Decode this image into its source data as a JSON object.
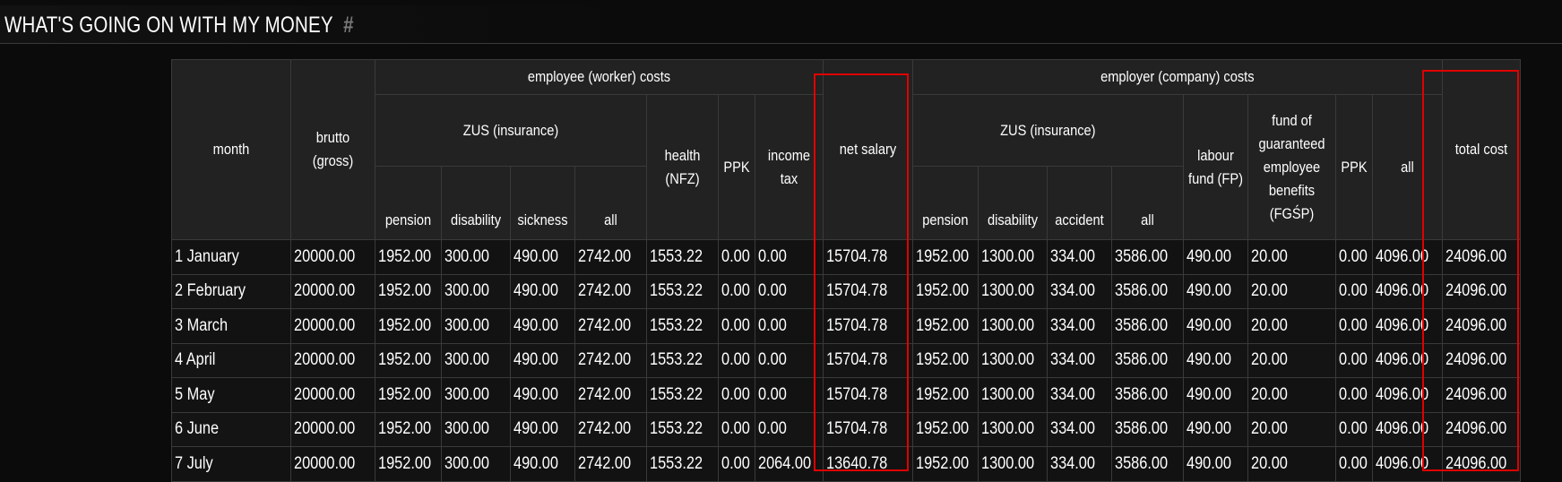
{
  "page": {
    "title": "WHAT'S GOING ON WITH MY MONEY",
    "anchor": "#"
  },
  "table": {
    "headers": {
      "month": "month",
      "gross": "brutto (gross)",
      "employee_group": "employee (worker) costs",
      "employer_group": "employer (company) costs",
      "zus": "ZUS (insurance)",
      "health": "health (NFZ)",
      "ppk": "PPK",
      "income_tax": "income tax",
      "net_salary": "net salary",
      "labour_fund": "labour fund (FP)",
      "fgsp": "fund of guaranteed employee benefits (FGŚP)",
      "all": "all",
      "total_cost": "total cost",
      "pension": "pension",
      "disability": "disability",
      "sickness": "sickness",
      "accident": "accident"
    },
    "rows": [
      {
        "month": "1 January",
        "gross": "20000.00",
        "e_pension": "1952.00",
        "e_disability": "300.00",
        "e_sickness": "490.00",
        "e_all": "2742.00",
        "health": "1553.22",
        "e_ppk": "0.00",
        "income_tax": "0.00",
        "net": "15704.78",
        "c_pension": "1952.00",
        "c_disability": "1300.00",
        "c_accident": "334.00",
        "c_all": "3586.00",
        "fp": "490.00",
        "fgsp": "20.00",
        "c_ppk": "0.00",
        "c_total_all": "4096.00",
        "total": "24096.00"
      },
      {
        "month": "2 February",
        "gross": "20000.00",
        "e_pension": "1952.00",
        "e_disability": "300.00",
        "e_sickness": "490.00",
        "e_all": "2742.00",
        "health": "1553.22",
        "e_ppk": "0.00",
        "income_tax": "0.00",
        "net": "15704.78",
        "c_pension": "1952.00",
        "c_disability": "1300.00",
        "c_accident": "334.00",
        "c_all": "3586.00",
        "fp": "490.00",
        "fgsp": "20.00",
        "c_ppk": "0.00",
        "c_total_all": "4096.00",
        "total": "24096.00"
      },
      {
        "month": "3 March",
        "gross": "20000.00",
        "e_pension": "1952.00",
        "e_disability": "300.00",
        "e_sickness": "490.00",
        "e_all": "2742.00",
        "health": "1553.22",
        "e_ppk": "0.00",
        "income_tax": "0.00",
        "net": "15704.78",
        "c_pension": "1952.00",
        "c_disability": "1300.00",
        "c_accident": "334.00",
        "c_all": "3586.00",
        "fp": "490.00",
        "fgsp": "20.00",
        "c_ppk": "0.00",
        "c_total_all": "4096.00",
        "total": "24096.00"
      },
      {
        "month": "4 April",
        "gross": "20000.00",
        "e_pension": "1952.00",
        "e_disability": "300.00",
        "e_sickness": "490.00",
        "e_all": "2742.00",
        "health": "1553.22",
        "e_ppk": "0.00",
        "income_tax": "0.00",
        "net": "15704.78",
        "c_pension": "1952.00",
        "c_disability": "1300.00",
        "c_accident": "334.00",
        "c_all": "3586.00",
        "fp": "490.00",
        "fgsp": "20.00",
        "c_ppk": "0.00",
        "c_total_all": "4096.00",
        "total": "24096.00"
      },
      {
        "month": "5 May",
        "gross": "20000.00",
        "e_pension": "1952.00",
        "e_disability": "300.00",
        "e_sickness": "490.00",
        "e_all": "2742.00",
        "health": "1553.22",
        "e_ppk": "0.00",
        "income_tax": "0.00",
        "net": "15704.78",
        "c_pension": "1952.00",
        "c_disability": "1300.00",
        "c_accident": "334.00",
        "c_all": "3586.00",
        "fp": "490.00",
        "fgsp": "20.00",
        "c_ppk": "0.00",
        "c_total_all": "4096.00",
        "total": "24096.00"
      },
      {
        "month": "6 June",
        "gross": "20000.00",
        "e_pension": "1952.00",
        "e_disability": "300.00",
        "e_sickness": "490.00",
        "e_all": "2742.00",
        "health": "1553.22",
        "e_ppk": "0.00",
        "income_tax": "0.00",
        "net": "15704.78",
        "c_pension": "1952.00",
        "c_disability": "1300.00",
        "c_accident": "334.00",
        "c_all": "3586.00",
        "fp": "490.00",
        "fgsp": "20.00",
        "c_ppk": "0.00",
        "c_total_all": "4096.00",
        "total": "24096.00"
      },
      {
        "month": "7 July",
        "gross": "20000.00",
        "e_pension": "1952.00",
        "e_disability": "300.00",
        "e_sickness": "490.00",
        "e_all": "2742.00",
        "health": "1553.22",
        "e_ppk": "0.00",
        "income_tax": "2064.00",
        "net": "13640.78",
        "c_pension": "1952.00",
        "c_disability": "1300.00",
        "c_accident": "334.00",
        "c_all": "3586.00",
        "fp": "490.00",
        "fgsp": "20.00",
        "c_ppk": "0.00",
        "c_total_all": "4096.00",
        "total": "24096.00"
      }
    ]
  },
  "highlight": {
    "color": "#e00000"
  }
}
